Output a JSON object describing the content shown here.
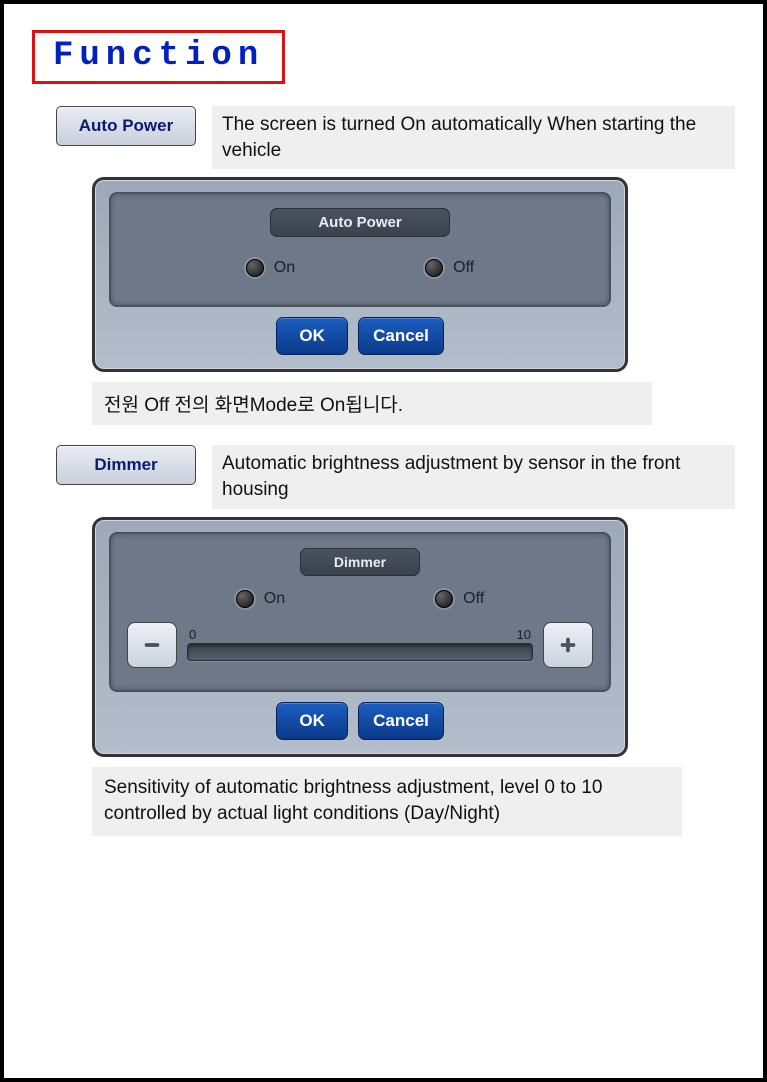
{
  "title": "Function",
  "sections": {
    "autopower": {
      "button_label": "Auto Power",
      "description": "The screen is turned On automatically When starting the vehicle",
      "panel_title": "Auto Power",
      "options": {
        "on": "On",
        "off": "Off"
      },
      "ok_label": "OK",
      "cancel_label": "Cancel",
      "footnote": "전원 Off 전의 화면Mode로 On됩니다."
    },
    "dimmer": {
      "button_label": "Dimmer",
      "description": "Automatic brightness adjustment by sensor in the front housing",
      "panel_title": "Dimmer",
      "options": {
        "on": "On",
        "off": "Off"
      },
      "slider": {
        "min_label": "0",
        "max_label": "10"
      },
      "ok_label": "OK",
      "cancel_label": "Cancel",
      "footnote": "Sensitivity of automatic brightness adjustment, level 0 to 10 controlled by actual light conditions (Day/Night)"
    }
  }
}
